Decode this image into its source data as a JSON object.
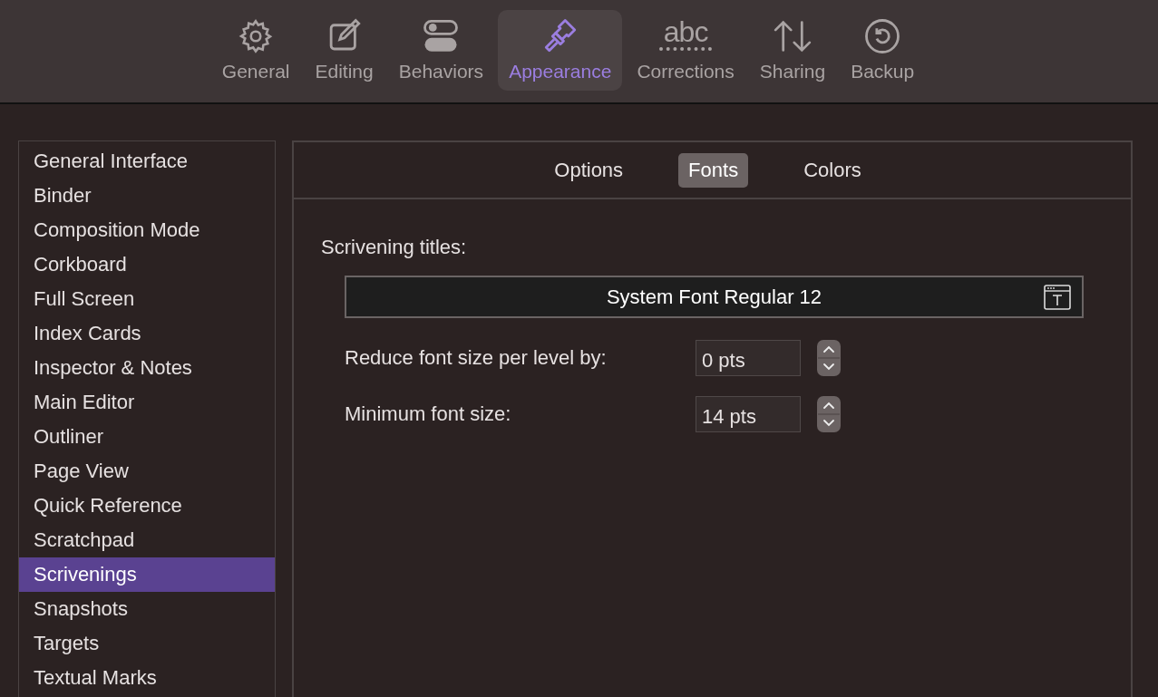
{
  "toolbar": [
    {
      "label": "General",
      "kind": "gear",
      "selected": false
    },
    {
      "label": "Editing",
      "kind": "edit",
      "selected": false
    },
    {
      "label": "Behaviors",
      "kind": "toggles",
      "selected": false
    },
    {
      "label": "Appearance",
      "kind": "brush",
      "selected": true
    },
    {
      "label": "Corrections",
      "kind": "abc",
      "icon_text": "abc",
      "selected": false
    },
    {
      "label": "Sharing",
      "kind": "arrows",
      "selected": false
    },
    {
      "label": "Backup",
      "kind": "restore",
      "selected": false
    }
  ],
  "sidebar": {
    "items": [
      {
        "label": "General Interface",
        "selected": false
      },
      {
        "label": "Binder",
        "selected": false
      },
      {
        "label": "Composition Mode",
        "selected": false
      },
      {
        "label": "Corkboard",
        "selected": false
      },
      {
        "label": "Full Screen",
        "selected": false
      },
      {
        "label": "Index Cards",
        "selected": false
      },
      {
        "label": "Inspector & Notes",
        "selected": false
      },
      {
        "label": "Main Editor",
        "selected": false
      },
      {
        "label": "Outliner",
        "selected": false
      },
      {
        "label": "Page View",
        "selected": false
      },
      {
        "label": "Quick Reference",
        "selected": false
      },
      {
        "label": "Scratchpad",
        "selected": false
      },
      {
        "label": "Scrivenings",
        "selected": true
      },
      {
        "label": "Snapshots",
        "selected": false
      },
      {
        "label": "Targets",
        "selected": false
      },
      {
        "label": "Textual Marks",
        "selected": false
      }
    ]
  },
  "panel": {
    "tabs": [
      {
        "label": "Options",
        "selected": false
      },
      {
        "label": "Fonts",
        "selected": true
      },
      {
        "label": "Colors",
        "selected": false
      }
    ],
    "section_label": "Scrivening titles:",
    "font_picker": {
      "value": "System Font Regular 12"
    },
    "fields": [
      {
        "label": "Reduce font size per level by:",
        "value": "0 pts"
      },
      {
        "label": "Minimum font size:",
        "value": "14 pts"
      }
    ]
  }
}
